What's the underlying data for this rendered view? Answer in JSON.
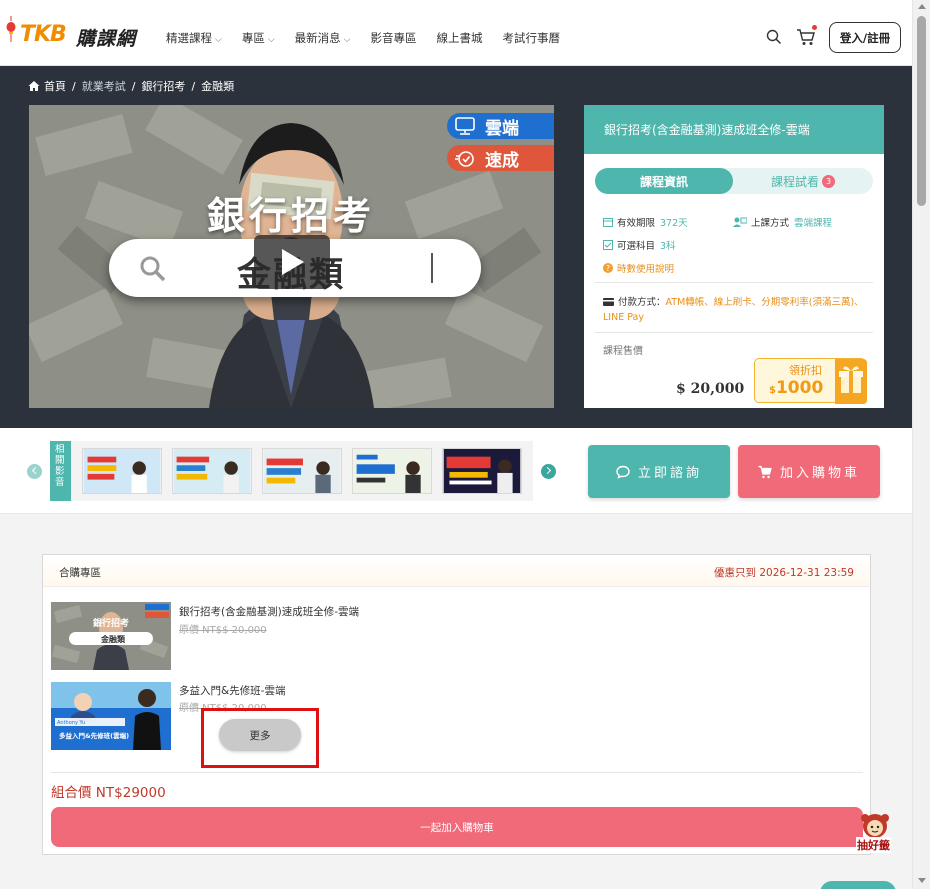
{
  "nav": {
    "brand": "TKB",
    "brand_zh": "購課網",
    "menu": [
      {
        "label": "精選課程",
        "dropdown": true
      },
      {
        "label": "專區",
        "dropdown": true
      },
      {
        "label": "最新消息",
        "dropdown": true
      },
      {
        "label": "影音專區",
        "dropdown": false
      },
      {
        "label": "線上書城",
        "dropdown": false
      },
      {
        "label": "考試行事曆",
        "dropdown": false
      }
    ],
    "login_label": "登入/註冊",
    "icons": {
      "search": "search-icon",
      "cart": "cart-icon"
    }
  },
  "breadcrumb": [
    "首頁",
    "就業考試",
    "銀行招考",
    "金融類"
  ],
  "video": {
    "title": "銀行招考",
    "search_text": "金融類",
    "badge_cloud": "雲端",
    "badge_fast": "速成"
  },
  "course": {
    "title": "銀行招考(含金融基測)速成班全修-雲端",
    "tab_info": "課程資訊",
    "tab_trial": "課程試看",
    "trial_count": "3",
    "validity_label": "有效期限",
    "validity_value": "372天",
    "method_label": "上課方式",
    "method_value": "雲端課程",
    "subjects_label": "可選科目",
    "subjects_value": "3科",
    "hours_note": "時數使用說明",
    "payment_label": "付款方式：",
    "payment_value": "ATM轉帳、線上刷卡、分期零利率(須滿三萬)、LINE Pay",
    "price_label": "課程售價",
    "price": "$ 20,000",
    "coupon_label": "領折扣",
    "coupon_currency": "$",
    "coupon_value": "1000"
  },
  "strip": {
    "tag": "相關影音",
    "consult_label": "立即諮詢",
    "cart_label": "加入購物車"
  },
  "bundle": {
    "title": "合購專區",
    "deadline": "優惠只到 2026-12-31 23:59",
    "items": [
      {
        "title": "銀行招考(含金融基測)速成班全修-雲端",
        "orig_price": "原價 NT$$ 20,000",
        "thumb_caption": "銀行招考",
        "thumb_search": "金融類"
      },
      {
        "title": "多益入門&先修班-雲端",
        "orig_price": "原價 NT$$ 20,000",
        "thumb_caption": "多益入門&先修班(雲端)",
        "thumb_name": "Anthony Yu"
      }
    ],
    "more_label": "更多",
    "combo_price": "組合價 NT$29000",
    "combo_btn": "一起加入購物車"
  },
  "lucky_draw": "抽好籤",
  "colors": {
    "teal": "#4fb6ad",
    "pink": "#f06a7a",
    "hero_bg": "#2b323c",
    "brand_orange": "#f08c00",
    "deadline_red": "#c0392b"
  }
}
